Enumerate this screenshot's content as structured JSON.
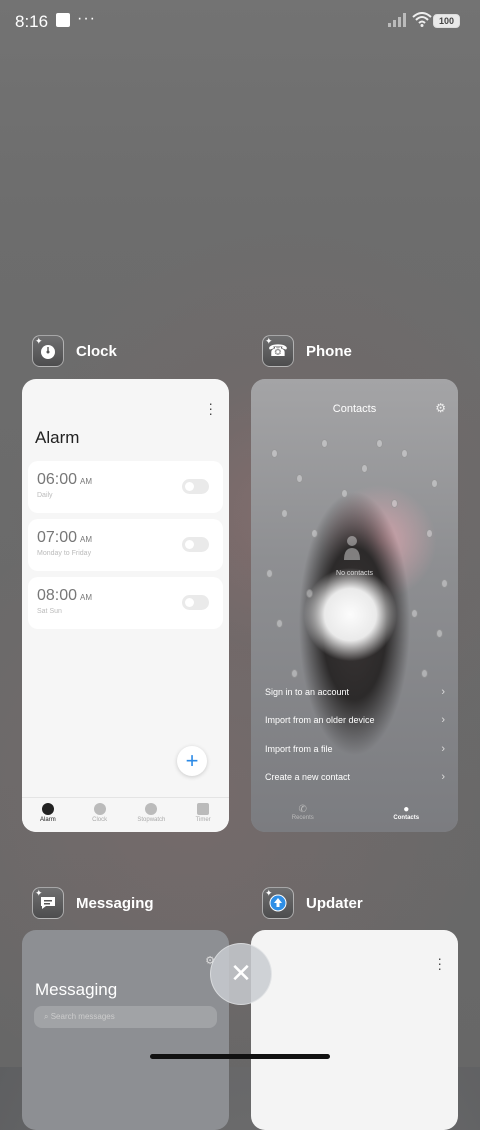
{
  "status_bar": {
    "time": "8:16",
    "battery": "100"
  },
  "apps": {
    "clock": {
      "name": "Clock"
    },
    "phone": {
      "name": "Phone"
    },
    "messaging": {
      "name": "Messaging"
    },
    "updater": {
      "name": "Updater"
    }
  },
  "clock_card": {
    "title": "Alarm",
    "alarms": [
      {
        "time": "06:00",
        "ampm": "AM",
        "repeat": "Daily"
      },
      {
        "time": "07:00",
        "ampm": "AM",
        "repeat": "Monday to Friday"
      },
      {
        "time": "08:00",
        "ampm": "AM",
        "repeat": "Sat Sun"
      }
    ],
    "fab_label": "+",
    "tabs": [
      "Alarm",
      "Clock",
      "Stopwatch",
      "Timer"
    ]
  },
  "phone_card": {
    "title": "Contacts",
    "empty_text": "No contacts",
    "actions": [
      "Sign in to an account",
      "Import from an older device",
      "Import from a file",
      "Create a new contact"
    ],
    "tabs": [
      "Recents",
      "Contacts"
    ]
  },
  "messaging_card": {
    "title": "Messaging",
    "search_placeholder": "Search messages"
  },
  "close_label": "✕"
}
